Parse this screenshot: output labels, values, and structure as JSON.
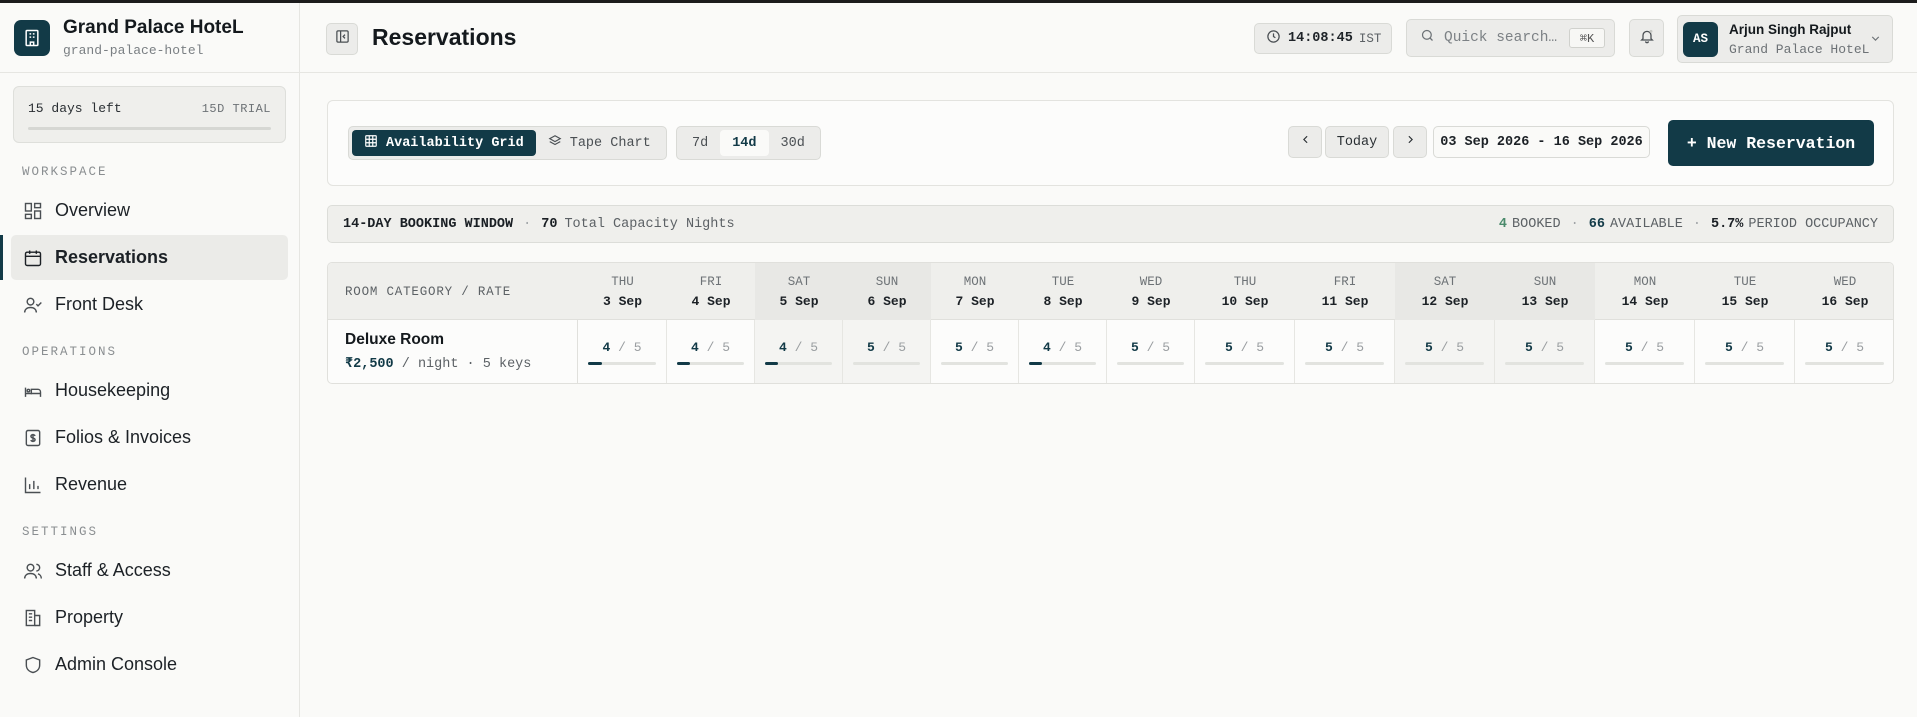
{
  "brand": {
    "name": "Grand Palace HoteL",
    "slug": "grand-palace-hotel"
  },
  "trial": {
    "days_left": "15 days left",
    "tag": "15D TRIAL"
  },
  "sidebar": {
    "workspace_label": "WORKSPACE",
    "operations_label": "OPERATIONS",
    "settings_label": "SETTINGS",
    "workspace": [
      {
        "label": "Overview",
        "icon": "grid-icon"
      },
      {
        "label": "Reservations",
        "icon": "calendar-icon",
        "active": true
      },
      {
        "label": "Front Desk",
        "icon": "user-check-icon"
      }
    ],
    "operations": [
      {
        "label": "Housekeeping",
        "icon": "bed-icon"
      },
      {
        "label": "Folios & Invoices",
        "icon": "invoice-icon"
      },
      {
        "label": "Revenue",
        "icon": "bar-chart-icon"
      }
    ],
    "settings": [
      {
        "label": "Staff & Access",
        "icon": "users-icon"
      },
      {
        "label": "Property",
        "icon": "building-icon"
      },
      {
        "label": "Admin Console",
        "icon": "shield-icon"
      }
    ]
  },
  "header": {
    "title": "Reservations",
    "clock_time": "14:08:45",
    "clock_tz": "IST",
    "search_placeholder": "Quick search…",
    "search_kbd": "⌘K",
    "user_initials": "AS",
    "user_name": "Arjun Singh Rajput",
    "user_hotel": "Grand Palace HoteL"
  },
  "toolbar": {
    "view_availability": "Availability Grid",
    "view_tape": "Tape Chart",
    "range_7": "7d",
    "range_14": "14d",
    "range_30": "30d",
    "today": "Today",
    "date_range": "03 Sep 2026 - 16 Sep 2026",
    "new_reservation": "+ New Reservation"
  },
  "summary": {
    "window_label": "14-DAY BOOKING WINDOW",
    "capacity_value": "70",
    "capacity_label": "Total Capacity Nights",
    "booked_value": "4",
    "booked_label": "BOOKED",
    "available_value": "66",
    "available_label": "AVAILABLE",
    "occupancy_value": "5.7%",
    "occupancy_label": "PERIOD OCCUPANCY"
  },
  "grid": {
    "header_label": "ROOM CATEGORY / RATE",
    "days": [
      {
        "dow": "THU",
        "date": "3 Sep",
        "weekend": false
      },
      {
        "dow": "FRI",
        "date": "4 Sep",
        "weekend": false
      },
      {
        "dow": "SAT",
        "date": "5 Sep",
        "weekend": true
      },
      {
        "dow": "SUN",
        "date": "6 Sep",
        "weekend": true
      },
      {
        "dow": "MON",
        "date": "7 Sep",
        "weekend": false
      },
      {
        "dow": "TUE",
        "date": "8 Sep",
        "weekend": false
      },
      {
        "dow": "WED",
        "date": "9 Sep",
        "weekend": false
      },
      {
        "dow": "THU",
        "date": "10 Sep",
        "weekend": false
      },
      {
        "dow": "FRI",
        "date": "11 Sep",
        "weekend": false
      },
      {
        "dow": "SAT",
        "date": "12 Sep",
        "weekend": true
      },
      {
        "dow": "SUN",
        "date": "13 Sep",
        "weekend": true
      },
      {
        "dow": "MON",
        "date": "14 Sep",
        "weekend": false
      },
      {
        "dow": "TUE",
        "date": "15 Sep",
        "weekend": false
      },
      {
        "dow": "WED",
        "date": "16 Sep",
        "weekend": false
      }
    ],
    "rows": [
      {
        "category": "Deluxe Room",
        "price": "₹2,500",
        "rate_suffix": "/ night · 5 keys",
        "cells": [
          {
            "available": 4,
            "total": 5,
            "fill": 0.2
          },
          {
            "available": 4,
            "total": 5,
            "fill": 0.2
          },
          {
            "available": 4,
            "total": 5,
            "fill": 0.2
          },
          {
            "available": 5,
            "total": 5,
            "fill": 0
          },
          {
            "available": 5,
            "total": 5,
            "fill": 0
          },
          {
            "available": 4,
            "total": 5,
            "fill": 0.2
          },
          {
            "available": 5,
            "total": 5,
            "fill": 0
          },
          {
            "available": 5,
            "total": 5,
            "fill": 0
          },
          {
            "available": 5,
            "total": 5,
            "fill": 0
          },
          {
            "available": 5,
            "total": 5,
            "fill": 0
          },
          {
            "available": 5,
            "total": 5,
            "fill": 0
          },
          {
            "available": 5,
            "total": 5,
            "fill": 0
          },
          {
            "available": 5,
            "total": 5,
            "fill": 0
          },
          {
            "available": 5,
            "total": 5,
            "fill": 0
          }
        ]
      }
    ]
  },
  "colors": {
    "accent": "#123a47",
    "booked": "#4a8a6b"
  }
}
